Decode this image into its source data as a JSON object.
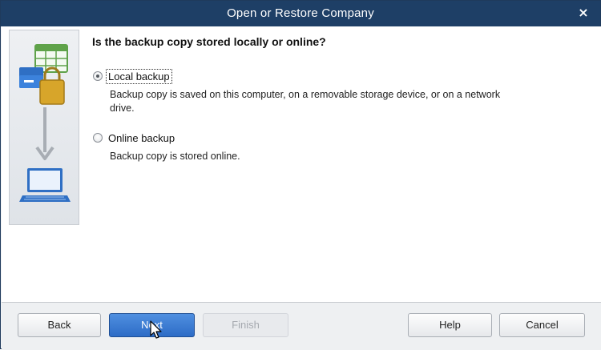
{
  "window": {
    "title": "Open or Restore Company",
    "close_glyph": "×"
  },
  "main": {
    "question": "Is the backup copy stored locally or online?",
    "options": [
      {
        "label": "Local backup",
        "description": "Backup copy is saved on this computer, on a removable storage device, or on a network drive.",
        "selected": true
      },
      {
        "label": "Online backup",
        "description": "Backup copy is stored online.",
        "selected": false
      }
    ]
  },
  "footer": {
    "back_label": "Back",
    "next_label": "Next",
    "finish_label": "Finish",
    "help_label": "Help",
    "cancel_label": "Cancel"
  },
  "icons": {
    "side_panel": [
      "spreadsheet-icon",
      "folder-icon",
      "lock-icon",
      "down-arrow-icon",
      "laptop-icon"
    ],
    "cursor": "mouse-pointer-icon"
  },
  "colors": {
    "titlebar": "#1e3f66",
    "primary_button": "#2d6cc6",
    "accent_green": "#5fa24a",
    "accent_gold": "#d7a52a",
    "accent_blue": "#2f6fc4"
  }
}
